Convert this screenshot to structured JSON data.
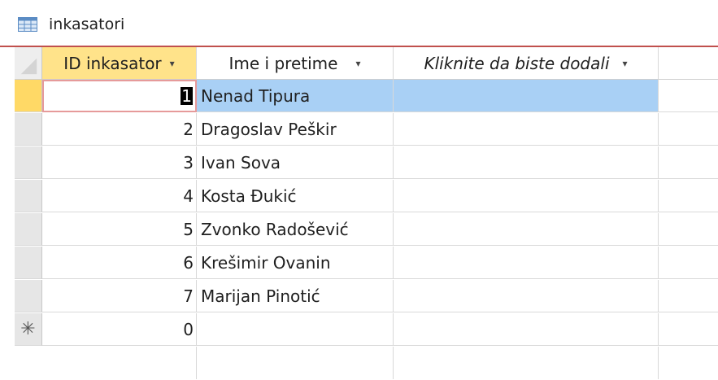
{
  "tab": {
    "icon": "table-icon",
    "label": "inkasatori"
  },
  "columns": [
    {
      "label": "ID inkasator",
      "dropdown": "▾"
    },
    {
      "label": "Ime i pretime",
      "dropdown": "▾"
    },
    {
      "label": "Kliknite da biste dodali",
      "dropdown": "▾"
    }
  ],
  "rows": [
    {
      "id": "1",
      "name": "Nenad Tipura"
    },
    {
      "id": "2",
      "name": "Dragoslav Peškir"
    },
    {
      "id": "3",
      "name": "Ivan Sova"
    },
    {
      "id": "4",
      "name": "Kosta Đukić"
    },
    {
      "id": "5",
      "name": "Zvonko Radošević"
    },
    {
      "id": "6",
      "name": "Krešimir Ovanin"
    },
    {
      "id": "7",
      "name": "Marijan Pinotić"
    }
  ],
  "new_row": {
    "marker": "✳",
    "id": "0"
  },
  "colors": {
    "accent_red": "#c0504d",
    "header_highlight": "#ffe38a",
    "selection_blue": "#a9d0f5"
  }
}
